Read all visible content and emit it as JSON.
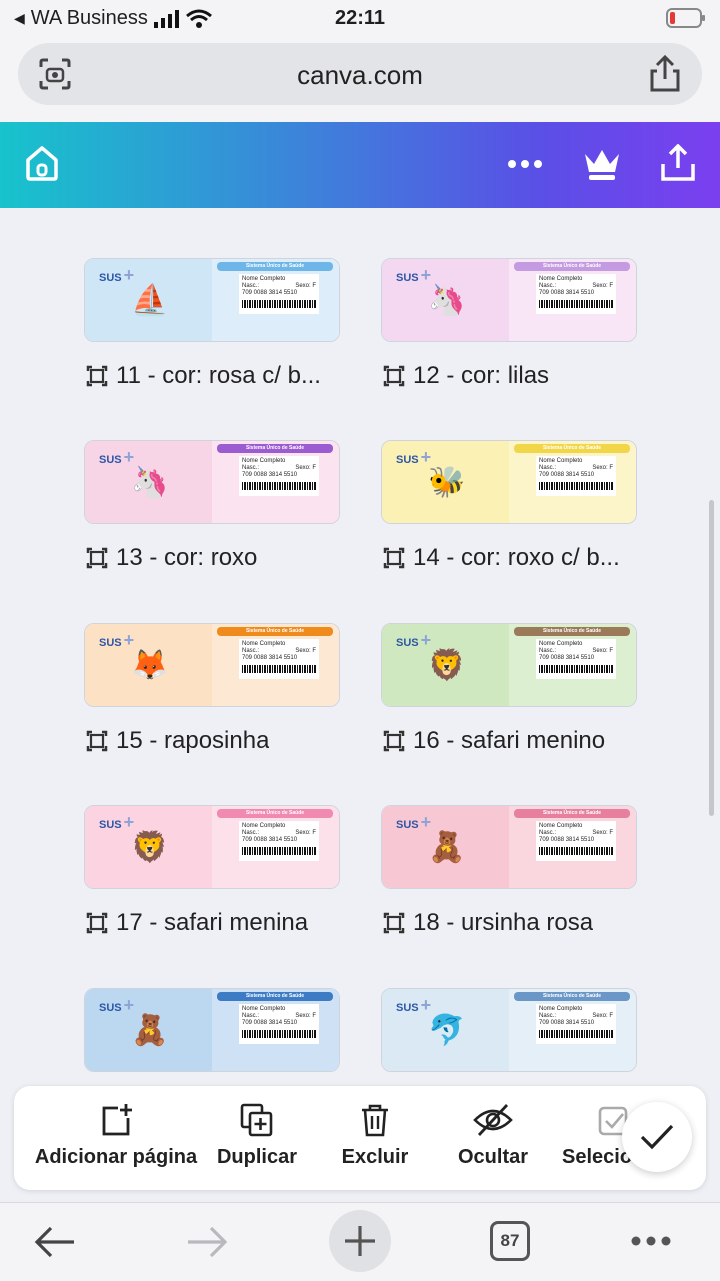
{
  "status": {
    "carrier": "WA Business",
    "time": "22:11"
  },
  "browser": {
    "domain": "canva.com",
    "tab_count": "87"
  },
  "pages": [
    {
      "caption": "11 - cor: rosa c/ b...",
      "accent": "#6fb6e8",
      "left": "#cfe6f7",
      "right": "#ddeefa",
      "deco": "⛵"
    },
    {
      "caption": "12 - cor: lilas",
      "accent": "#c49be0",
      "left": "#f4d8f2",
      "right": "#f8e6f7",
      "deco": "🦄"
    },
    {
      "caption": "13 - cor: roxo",
      "accent": "#9b5bd1",
      "left": "#f7d4e6",
      "right": "#fbe3ef",
      "deco": "🦄"
    },
    {
      "caption": "14 - cor: roxo c/ b...",
      "accent": "#f2d64a",
      "left": "#fbf1b5",
      "right": "#fcf5c9",
      "deco": "🐝"
    },
    {
      "caption": "15 - raposinha",
      "accent": "#ef8a1c",
      "left": "#fde1c4",
      "right": "#fde9d3",
      "deco": "🦊"
    },
    {
      "caption": "16 - safari menino",
      "accent": "#9b7a5a",
      "left": "#cfe8bf",
      "right": "#dcefd0",
      "deco": "🦁"
    },
    {
      "caption": "17 - safari menina",
      "accent": "#f08ab0",
      "left": "#fbd3e1",
      "right": "#fce0ea",
      "deco": "🦁"
    },
    {
      "caption": "18 - ursinha rosa",
      "accent": "#e77f9f",
      "left": "#f8c7d4",
      "right": "#fad6df",
      "deco": "🧸"
    },
    {
      "caption": "",
      "accent": "#3d7cc4",
      "left": "#bcd7f0",
      "right": "#cfe2f5",
      "deco": "🧸"
    },
    {
      "caption": "",
      "accent": "#6a97c8",
      "left": "#dbe9f5",
      "right": "#e5eff8",
      "deco": "🐬"
    }
  ],
  "card_text": {
    "sus": "SUS",
    "tag": "Sistema Único de Saúde",
    "name": "Nome Completo",
    "nasc": "Nasc.:",
    "sexo": "Sexo: F",
    "number": "709 0088 3814 5510"
  },
  "toolbar": {
    "add_page": "Adicionar página",
    "duplicate": "Duplicar",
    "delete": "Excluir",
    "hide": "Ocultar",
    "select": "Selecio"
  },
  "colors": {
    "header_start": "#17c3cc",
    "header_end": "#7b3ff0"
  }
}
